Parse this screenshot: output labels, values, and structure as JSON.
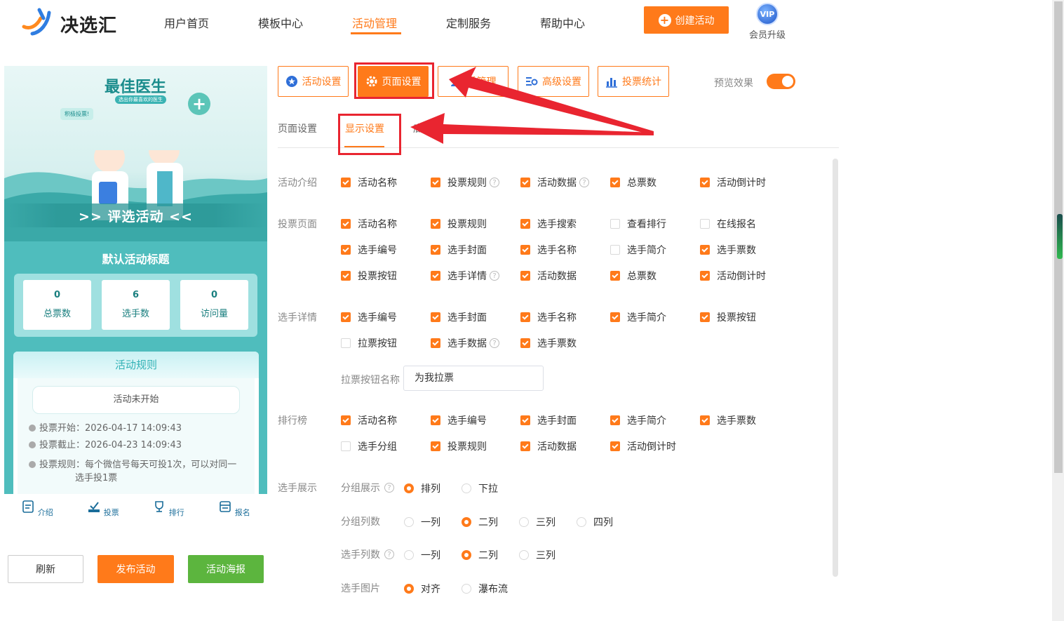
{
  "header": {
    "brand": "决选汇",
    "nav": [
      "用户首页",
      "模板中心",
      "活动管理",
      "定制服务",
      "帮助中心"
    ],
    "create_label": "创建活动",
    "vip_badge": "VIP",
    "vip_label": "会员升级",
    "accent": "#ff7a1a"
  },
  "preview": {
    "banner_title": "最佳医生",
    "banner_sub": "选出你最喜欢的医生",
    "banner_tag": "积极投票!",
    "banner_strip": ">> 评选活动 <<",
    "activity_title": "默认活动标题",
    "stats": [
      {
        "value": "0",
        "label": "总票数"
      },
      {
        "value": "6",
        "label": "选手数"
      },
      {
        "value": "0",
        "label": "访问量"
      }
    ],
    "rules_title": "活动规则",
    "status": "活动未开始",
    "rule_lines": [
      "投票开始：2026-04-17 14:09:43",
      "投票截止：2026-04-23 14:09:43",
      "投票规则：每个微信号每天可投1次，可以对同一",
      "选手投1票"
    ],
    "tabs": [
      "介绍",
      "投票",
      "排行",
      "报名"
    ],
    "buttons": {
      "refresh": "刷新",
      "publish": "发布活动",
      "poster": "活动海报"
    }
  },
  "main_tabs": [
    "活动设置",
    "页面设置",
    "选手管理",
    "高级设置",
    "投票统计"
  ],
  "main_tab_visible": [
    "活动设置",
    "页面设置",
    "手管理",
    "高级设置",
    "投票统计"
  ],
  "preview_toggle": {
    "label": "预览效果",
    "on": true
  },
  "sub_tabs": [
    "页面设置",
    "显示设置",
    "底"
  ],
  "sections": {
    "intro": {
      "label": "活动介绍",
      "items": [
        {
          "label": "活动名称",
          "checked": true,
          "help": false
        },
        {
          "label": "投票规则",
          "checked": true,
          "help": true
        },
        {
          "label": "活动数据",
          "checked": true,
          "help": true
        },
        {
          "label": "总票数",
          "checked": true,
          "help": false
        },
        {
          "label": "活动倒计时",
          "checked": true,
          "help": false
        }
      ]
    },
    "vote_page": {
      "label": "投票页面",
      "items": [
        {
          "label": "活动名称",
          "checked": true,
          "help": false
        },
        {
          "label": "投票规则",
          "checked": true,
          "help": false
        },
        {
          "label": "选手搜索",
          "checked": true,
          "help": false
        },
        {
          "label": "查看排行",
          "checked": false,
          "help": false
        },
        {
          "label": "在线报名",
          "checked": false,
          "help": false
        },
        {
          "label": "选手编号",
          "checked": true,
          "help": false
        },
        {
          "label": "选手封面",
          "checked": true,
          "help": false
        },
        {
          "label": "选手名称",
          "checked": true,
          "help": false
        },
        {
          "label": "选手简介",
          "checked": false,
          "help": false
        },
        {
          "label": "选手票数",
          "checked": true,
          "help": false
        },
        {
          "label": "投票按钮",
          "checked": true,
          "help": false
        },
        {
          "label": "选手详情",
          "checked": true,
          "help": true
        },
        {
          "label": "活动数据",
          "checked": true,
          "help": false
        },
        {
          "label": "总票数",
          "checked": true,
          "help": false
        },
        {
          "label": "活动倒计时",
          "checked": true,
          "help": false
        }
      ]
    },
    "player_detail": {
      "label": "选手详情",
      "items": [
        {
          "label": "选手编号",
          "checked": true,
          "help": false
        },
        {
          "label": "选手封面",
          "checked": true,
          "help": false
        },
        {
          "label": "选手名称",
          "checked": true,
          "help": false
        },
        {
          "label": "选手简介",
          "checked": true,
          "help": false
        },
        {
          "label": "投票按钮",
          "checked": true,
          "help": false
        },
        {
          "label": "拉票按钮",
          "checked": false,
          "help": false
        },
        {
          "label": "选手数据",
          "checked": true,
          "help": true
        },
        {
          "label": "选手票数",
          "checked": true,
          "help": false
        }
      ],
      "canvass_label": "拉票按钮名称",
      "canvass_value": "为我拉票"
    },
    "ranking": {
      "label": "排行榜",
      "items": [
        {
          "label": "活动名称",
          "checked": true,
          "help": false
        },
        {
          "label": "选手编号",
          "checked": true,
          "help": false
        },
        {
          "label": "选手封面",
          "checked": true,
          "help": false
        },
        {
          "label": "选手简介",
          "checked": true,
          "help": false
        },
        {
          "label": "选手票数",
          "checked": true,
          "help": false
        },
        {
          "label": "选手分组",
          "checked": false,
          "help": false
        },
        {
          "label": "投票规则",
          "checked": true,
          "help": false
        },
        {
          "label": "活动数据",
          "checked": true,
          "help": false
        },
        {
          "label": "活动倒计时",
          "checked": true,
          "help": false
        }
      ]
    },
    "display": {
      "label": "选手展示",
      "rows": [
        {
          "label": "分组展示",
          "help": true,
          "options": [
            "排列",
            "下拉"
          ],
          "selected": 0
        },
        {
          "label": "分组列数",
          "help": false,
          "options": [
            "一列",
            "二列",
            "三列",
            "四列"
          ],
          "selected": 1
        },
        {
          "label": "选手列数",
          "help": true,
          "options": [
            "一列",
            "二列",
            "三列"
          ],
          "selected": 1
        },
        {
          "label": "选手图片",
          "help": false,
          "options": [
            "对齐",
            "瀑布流"
          ],
          "selected": 0
        }
      ]
    }
  }
}
